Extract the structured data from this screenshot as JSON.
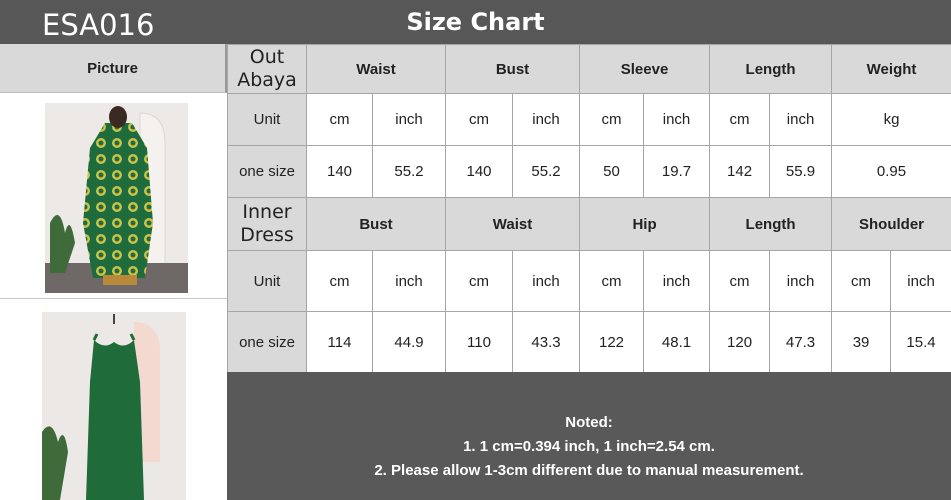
{
  "header": {
    "code": "ESA016",
    "title": "Size Chart"
  },
  "picture_header": "Picture",
  "outer": {
    "label_line1": "Out",
    "label_line2": "Abaya",
    "groups": [
      "Waist",
      "Bust",
      "Sleeve",
      "Length",
      "Weight"
    ],
    "unit_label": "Unit",
    "units": [
      "cm",
      "inch",
      "cm",
      "inch",
      "cm",
      "inch",
      "cm",
      "inch",
      "kg"
    ],
    "size_label": "one size",
    "values": [
      "140",
      "55.2",
      "140",
      "55.2",
      "50",
      "19.7",
      "142",
      "55.9",
      "0.95"
    ]
  },
  "inner": {
    "label_line1": "Inner",
    "label_line2": "Dress",
    "groups": [
      "Bust",
      "Waist",
      "Hip",
      "Length",
      "Shoulder"
    ],
    "unit_label": "Unit",
    "units": [
      "cm",
      "inch",
      "cm",
      "inch",
      "cm",
      "inch",
      "cm",
      "inch",
      "cm",
      "inch"
    ],
    "size_label": "one size",
    "values": [
      "114",
      "44.9",
      "110",
      "43.3",
      "122",
      "48.1",
      "120",
      "47.3",
      "39",
      "15.4"
    ]
  },
  "notes": {
    "title": "Noted:",
    "line1": "1. 1 cm=0.394 inch, 1 inch=2.54 cm.",
    "line2": "2. Please allow 1-3cm different due to manual measurement."
  },
  "colors": {
    "header_bar": "#575757",
    "cell_gray": "#d9d9d9",
    "notes_bg": "#595959",
    "garment_green": "#1f6b3a"
  }
}
